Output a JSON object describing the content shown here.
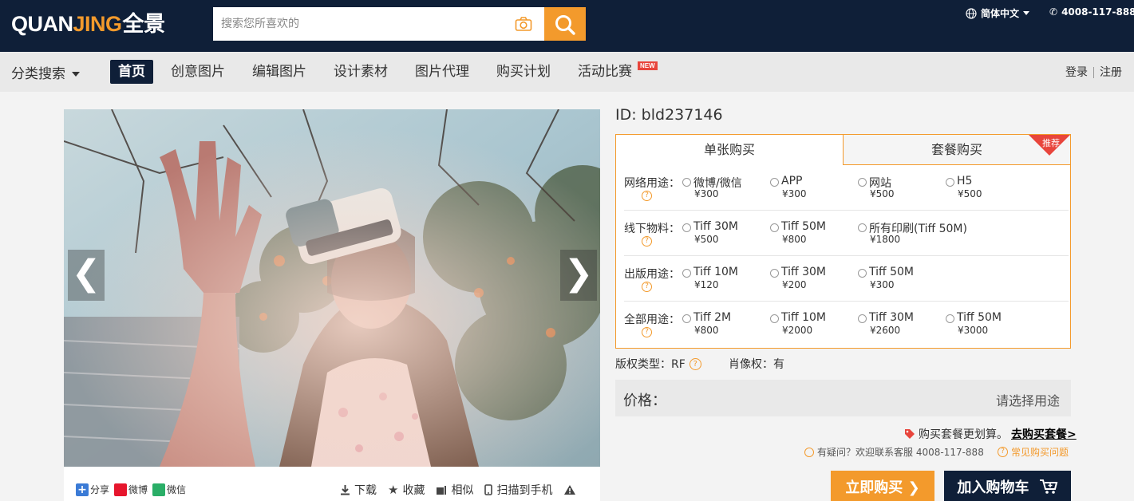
{
  "header": {
    "logo_part1": "QUAN",
    "logo_part2": "JING",
    "logo_cn": "全景",
    "search_placeholder": "搜索您所喜欢的",
    "language": "简体中文",
    "phone": "4008-117-888"
  },
  "nav": {
    "category_label": "分类搜索",
    "items": [
      {
        "label": "首页"
      },
      {
        "label": "创意图片"
      },
      {
        "label": "编辑图片"
      },
      {
        "label": "设计素材"
      },
      {
        "label": "图片代理"
      },
      {
        "label": "购买计划"
      },
      {
        "label": "活动比赛"
      }
    ],
    "new_badge": "NEW",
    "login": "登录",
    "register": "注册"
  },
  "photo": {
    "prev": "❮",
    "next": "❯"
  },
  "tools": {
    "share": "分享",
    "weibo": "微博",
    "wechat": "微信",
    "download": "下载",
    "favorite": "收藏",
    "similar": "相似",
    "scan": "扫描到手机"
  },
  "product": {
    "id": "ID: bld237146",
    "tab_single": "单张购买",
    "tab_package": "套餐购买",
    "recommend": "推荐",
    "rows": [
      {
        "label": "网络用途：",
        "options": [
          {
            "name": "微博/微信",
            "price": "¥300"
          },
          {
            "name": "APP",
            "price": "¥300"
          },
          {
            "name": "网站",
            "price": "¥500"
          },
          {
            "name": "H5",
            "price": "¥500"
          }
        ]
      },
      {
        "label": "线下物料：",
        "options": [
          {
            "name": "Tiff 30M",
            "price": "¥500"
          },
          {
            "name": "Tiff 50M",
            "price": "¥800"
          },
          {
            "name": "所有印刷(Tiff 50M)",
            "price": "¥1800"
          }
        ]
      },
      {
        "label": "出版用途：",
        "options": [
          {
            "name": "Tiff 10M",
            "price": "¥120"
          },
          {
            "name": "Tiff 30M",
            "price": "¥200"
          },
          {
            "name": "Tiff 50M",
            "price": "¥300"
          }
        ]
      },
      {
        "label": "全部用途：",
        "options": [
          {
            "name": "Tiff 2M",
            "price": "¥800"
          },
          {
            "name": "Tiff 10M",
            "price": "¥2000"
          },
          {
            "name": "Tiff 30M",
            "price": "¥2600"
          },
          {
            "name": "Tiff 50M",
            "price": "¥3000"
          }
        ]
      }
    ],
    "license_type": "版权类型：RF",
    "portrait_right": "肖像权：有",
    "price_label": "价格：",
    "price_hint": "请选择用途",
    "promo_text": "购买套餐更划算。",
    "promo_link": "去购买套餐>",
    "help_text": "有疑问？欢迎联系客服 4008-117-888",
    "faq": "常见购买问题",
    "buy_now": "立即购买",
    "add_cart": "加入购物车"
  },
  "colors": {
    "brand_dark": "#0f1f38",
    "accent": "#f39a2c",
    "badge": "#e8453c"
  }
}
